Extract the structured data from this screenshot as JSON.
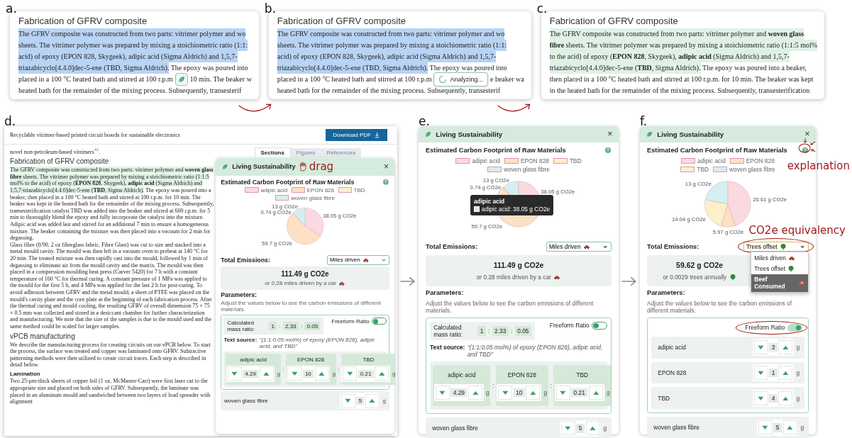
{
  "top_cards": [
    {
      "label": "a.",
      "heading": "Fabrication of GFRV composite",
      "lines": [
        [
          {
            "kind": "selected",
            "text": "The GFRV composite was constructed from two parts: vitrimer polymer and wo"
          }
        ],
        [
          {
            "kind": "selected",
            "text": "sheets. The vitrimer polymer was prepared by mixing a stoichiometric ratio (1:1:"
          }
        ],
        [
          {
            "kind": "selected",
            "text": "acid) of epoxy (EPON 828, Skygeek), adipic acid (Sigma Aldrich) and 1,5,7-"
          }
        ],
        [
          {
            "kind": "selected",
            "text": "triazabicyclo[4.4.0]dec-5-ene (TBD, Sigma Aldrich)."
          },
          {
            "kind": "text",
            "text": " The epoxy was poured into"
          }
        ],
        [
          {
            "kind": "text",
            "text": "placed in a 100 °C heated bath and stirred at 100 r.p.m"
          },
          {
            "kind": "leaf-button"
          },
          {
            "kind": "text",
            "text": "10 min. The beaker w"
          }
        ],
        [
          {
            "kind": "text",
            "text": "heated bath for the remainder of the mixing process. Subsequently, transesterif"
          }
        ]
      ]
    },
    {
      "label": "b.",
      "heading": "Fabrication of GFRV composite",
      "lines": [
        [
          {
            "kind": "selected",
            "text": "The GFRV composite was constructed from two parts: vitrimer polymer and wo"
          }
        ],
        [
          {
            "kind": "selected",
            "text": "sheets. The vitrimer polymer was prepared by mixing a stoichiometric ratio (1:1:"
          }
        ],
        [
          {
            "kind": "selected",
            "text": "acid) of epoxy (EPON 828, Skygeek), adipic acid (Sigma Aldrich) and 1,5,7-"
          }
        ],
        [
          {
            "kind": "selected",
            "text": "triazabicyclo[4.4.0]dec-5-ene (TBD, Sigma Aldrich)."
          },
          {
            "kind": "text",
            "text": " The epoxy was poured into"
          }
        ],
        [
          {
            "kind": "text",
            "text": "placed in a 100 °C heated bath and stirred at 100 r.p.m"
          },
          {
            "kind": "analyzing-pill",
            "text": "Analyzing..."
          },
          {
            "kind": "text",
            "text": "e beaker wa"
          }
        ],
        [
          {
            "kind": "text",
            "text": "heated bath for the remainder of the mixing process. Subsequently, transesterif"
          }
        ]
      ]
    },
    {
      "label": "c.",
      "heading": "Fabrication of GFRV composite",
      "lines": [
        [
          {
            "kind": "highlight",
            "text": "The GFRV composite was constructed from two parts: vitrimer polymer and **woven glass**"
          }
        ],
        [
          {
            "kind": "highlight",
            "text": "**fibre** sheets. The vitrimer polymer was prepared by mixing a stoichiometric ratio (1:1:5 mol%"
          }
        ],
        [
          {
            "kind": "highlight",
            "text": "to the acid) of epoxy (**EPON 828**, Skygeek), **adipic acid** (Sigma Aldrich) and 1,5,7-"
          }
        ],
        [
          {
            "kind": "highlight",
            "text": "triazabicyclo[4.4.0]dec-5-ene (**TBD**, Sigma Aldrich)."
          },
          {
            "kind": "text",
            "text": " The epoxy was poured into a beaker,"
          }
        ],
        [
          {
            "kind": "text",
            "text": "then placed in a 100 °C heated bath and stirred at 100 r.p.m. for 10 min. The beaker was kept"
          }
        ],
        [
          {
            "kind": "text",
            "text": "in the heated bath for the remainder of the mixing process. Subsequently, transesterification"
          }
        ]
      ]
    }
  ],
  "article": {
    "label": "d.",
    "running_title": "Recyclable vitrimer-based printed circuit boards for sustainable electronics",
    "download": "Download PDF",
    "tabs": [
      {
        "label": "Sections",
        "selected": true
      },
      {
        "label": "Figures",
        "selected": false
      },
      {
        "label": "References",
        "selected": false
      }
    ],
    "blocks": [
      {
        "kind": "paragraph",
        "segments": [
          {
            "kind": "text",
            "text": "novel non-petroleum-based vitrimers$^{42}$."
          }
        ]
      },
      {
        "kind": "heading",
        "text": "Fabrication of GFRV composite"
      },
      {
        "kind": "paragraph",
        "segments": [
          {
            "kind": "highlight",
            "text": "The GFRV composite was constructed from two parts: vitrimer polymer and **woven glass fibre** sheets. The vitrimer polymer was prepared by mixing a stoichiometric ratio (1:1:5 mol% to the acid) of epoxy (**EPON 828**, Skygeek), **adipic acid** (Sigma Aldrich) and 1,5,7-triazabicyclo[4.4.0]dec-5-ene (**TBD**, Sigma Aldrich)."
          },
          {
            "kind": "text",
            "text": " The epoxy was poured into a beaker, then placed in a 100 °C heated bath and stirred at 100 r.p.m. for 10 min. The beaker was kept in the heated bath for the remainder of the mixing process. Subsequently, transesterification catalyst TBD was added into the beaker and stirred at 600 r.p.m. for 5 min to thoroughly blend the epoxy and fully incorporate the catalyst into the mixture. Adipic acid was added last and stirred for an additional 7 min to ensure a homogeneous mixture. The beaker containing the mixture was then placed into a vacuum for 2 min for degassing."
          }
        ]
      },
      {
        "kind": "paragraph",
        "segments": [
          {
            "kind": "text",
            "text": "Glass fibre (0/90, 2 oz fibreglass fabric, Fibre Glast) was cut to size and stacked into a metal mould cavity. The mould was then left in a vacuum oven to preheat at 140 °C for 20 min. The treated mixture was then rapidly cast into the mould, followed by 1 min of degassing to eliminate air from the mould cavity and the matrix. The mould was then placed in a compression moulding heat press (Carver 5420) for 7 h with a constant temperature of 160 °C for thermal curing. A constant pressure of 1 MPa was applied to the mould for the first 5 h, and 4 MPa was applied for the last 2 h for post-curing. To avoid adhesion between GFRV and the metal mould, a sheet of PTFE was placed on the mould's cavity plate and the core plate at the beginning of each fabrication process. After the thermal curing and mould cooling, the resulting GFRV of overall dimension 75 × 75 × 0.5 mm was collected and stored in a desiccant chamber for further characterization and manufacturing. We note that the size of the samples is due to the mould used and the same method could be scaled for larger samples."
          }
        ]
      },
      {
        "kind": "heading",
        "text": "vPCB manufacturing"
      },
      {
        "kind": "paragraph",
        "segments": [
          {
            "kind": "text",
            "text": "We describe the manufacturing process for creating circuits on our vPCB below. To start the process, the surface was treated and copper was laminated onto GFRV. Subtractive patterning methods were then utilized to create circuit traces. Each step is described in detail below."
          }
        ]
      },
      {
        "kind": "subheading",
        "text": "Lamination"
      },
      {
        "kind": "paragraph",
        "segments": [
          {
            "kind": "text",
            "text": "Two 25-μm-thick sheets of copper foil (1 oz, McMaster-Carr) were first laser cut to the appropriate size and placed on both sides of GFRV. Subsequently, the laminate was placed in an aluminum mould and sandwiched between two layers of load spreader with alignment"
          }
        ]
      }
    ]
  },
  "panels": [
    {
      "title": "Living Sustainability",
      "close": "×",
      "chart_title": "Estimated Carbon Footprint of Raw Materials",
      "chart_data": {
        "type": "pie",
        "legend": "top",
        "categories": [
          "adipic acid",
          "EPON 828",
          "TBD",
          "woven glass fibre"
        ],
        "values": [
          38.05,
          59.7,
          0.74,
          13
        ],
        "colors": [
          "#fbd9e1",
          "#fde0c6",
          "#fdefc9",
          "#d4eff1"
        ],
        "value_labels": [
          "38.05 g CO2e",
          "59.7 g CO2e",
          "0.74 g CO2e",
          "13 g CO2e"
        ]
      },
      "total_label": "Total Emissions:",
      "select": {
        "label": "Miles driven",
        "kind": "car",
        "open": false
      },
      "total": {
        "value": "111.49 g CO2e",
        "equivalent": "or 0.28 miles driven by a car",
        "kind": "car"
      },
      "params_title": "Parameters:",
      "params_hint": "Adjust the values below to see the carbon emissions of different materials.",
      "ratio_box": {
        "freeform_label": "Freeform Ratio",
        "freeform_on": false,
        "ratio_label": "Calculated mass ratio:",
        "ratio_values": [
          "1",
          "2.33",
          "0.05"
        ],
        "separator": ":",
        "source_label": "Text source:",
        "source_text": "\"(1:1:0.05 mol%) of epoxy (EPON 828), adipic acid, and TBD\"",
        "materials": [
          {
            "name": "adipic acid",
            "value": "4.29",
            "unit": "g"
          },
          {
            "name": "EPON 828",
            "value": "10",
            "unit": "g"
          },
          {
            "name": "TBD",
            "value": "0.21",
            "unit": "g"
          }
        ]
      },
      "extra_material": {
        "name": "woven glass fibre",
        "value": "5",
        "unit": "g"
      },
      "annotations": [
        {
          "kind": "drag",
          "text": "drag"
        }
      ]
    },
    {
      "label": "e.",
      "title": "Living Sustainability",
      "close": "×",
      "chart_title": "Estimated Carbon Footprint of Raw Materials",
      "chart_data": {
        "type": "pie",
        "legend": "top",
        "categories": [
          "adipic acid",
          "EPON 828",
          "TBD",
          "woven glass fibre"
        ],
        "values": [
          38.05,
          59.7,
          0.74,
          13
        ],
        "colors": [
          "#fbd9e1",
          "#fde0c6",
          "#fdefc9",
          "#d4eff1"
        ],
        "value_labels": [
          "38.05 g CO2e",
          "59.7 g CO2e",
          "0.74 g CO2e",
          "13 g CO2e"
        ]
      },
      "tooltip": {
        "title": "adipic acid",
        "text": "adipic acid: 38.05 g CO2e",
        "color": "#fbd9e1"
      },
      "total_label": "Total Emissions:",
      "select": {
        "label": "Miles driven",
        "kind": "car",
        "open": false
      },
      "total": {
        "value": "111.49 g CO2e",
        "equivalent": "or 0.28 miles driven by a car",
        "kind": "car"
      },
      "params_title": "Parameters:",
      "params_hint": "Adjust the values below to see the carbon emissions of different materials.",
      "ratio_box": {
        "freeform_label": "Freeform Ratio",
        "freeform_on": false,
        "ratio_label": "Calculated mass ratio:",
        "ratio_values": [
          "1",
          "2.33",
          "0.05"
        ],
        "separator": ":",
        "source_label": "Text source:",
        "source_text": "\"(1:1:0.05 mol%) of epoxy (EPON 828), adipic acid, and TBD\"",
        "materials": [
          {
            "name": "adipic acid",
            "value": "4.29",
            "unit": "g"
          },
          {
            "name": "EPON 828",
            "value": "10",
            "unit": "g"
          },
          {
            "name": "TBD",
            "value": "0.21",
            "unit": "g"
          }
        ]
      },
      "extra_material": {
        "name": "woven glass fibre",
        "value": "5",
        "unit": "g"
      }
    },
    {
      "label": "f.",
      "title": "Living Sustainability",
      "close": "×",
      "chart_title": "Estimated Carbon Footprint of Raw Materials",
      "chart_data": {
        "type": "pie",
        "legend": "top",
        "categories": [
          "adipic acid",
          "EPON 828",
          "TBD",
          "woven glass fibre"
        ],
        "values": [
          26.61,
          5.97,
          14.04,
          13
        ],
        "colors": [
          "#fbd9e1",
          "#fde0c6",
          "#fdefc9",
          "#d4eff1"
        ],
        "value_labels": [
          "26.61 g CO2e",
          "5.97 g CO2e",
          "14.04 g CO2e",
          "13 g CO2e"
        ]
      },
      "total_label": "Total Emissions:",
      "select": {
        "label": "Trees offset",
        "kind": "tree",
        "open": true,
        "options": [
          {
            "label": "Miles driven",
            "kind": "car",
            "highlighted": false
          },
          {
            "label": "Trees offset",
            "kind": "tree",
            "highlighted": false
          },
          {
            "label": "Beef Consumed",
            "kind": "beef",
            "highlighted": true
          }
        ]
      },
      "total": {
        "value": "59.62 g CO2e",
        "equivalent": "or 0.0029 trees annually",
        "kind": "tree"
      },
      "params_title": "Parameters:",
      "params_hint": "Adjust the values below to see the carbon emissions of different materials.",
      "ratio_box": {
        "freeform_label": "Freeform Ratio",
        "freeform_on": true,
        "materials": [
          {
            "name": "adipic acid",
            "value": "3",
            "unit": "g"
          },
          {
            "name": "EPON 828",
            "value": "1",
            "unit": "g"
          },
          {
            "name": "TBD",
            "value": "4",
            "unit": "g"
          }
        ]
      },
      "extra_material": {
        "name": "woven glass fibre",
        "value": "5",
        "unit": "g"
      },
      "annotations": [
        {
          "kind": "explanation",
          "text": "explanation"
        },
        {
          "kind": "equivalency",
          "text": "CO2e equivalency"
        },
        {
          "kind": "select-circle"
        },
        {
          "kind": "freeform-circle"
        }
      ]
    }
  ]
}
